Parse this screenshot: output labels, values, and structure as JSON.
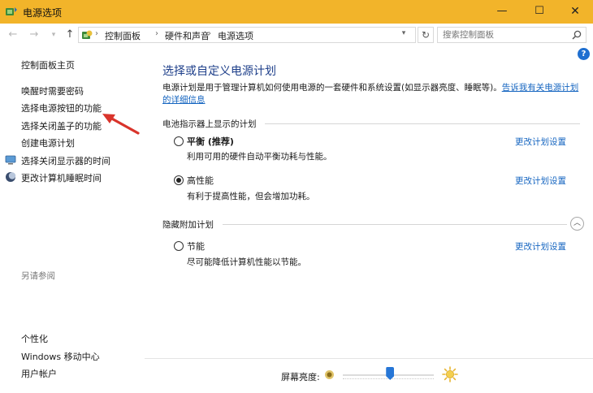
{
  "window": {
    "title": "电源选项",
    "minimize_label": "—",
    "maximize_label": "☐",
    "close_label": "✕"
  },
  "address": {
    "crumbs": [
      "控制面板",
      "硬件和声音",
      "电源选项"
    ],
    "search_placeholder": "搜索控制面板"
  },
  "left_pane": {
    "home": "控制面板主页",
    "links": [
      "唤醒时需要密码",
      "选择电源按钮的功能",
      "选择关闭盖子的功能",
      "创建电源计划",
      "选择关闭显示器的时间",
      "更改计算机睡眠时间"
    ],
    "see_also_title": "另请参阅",
    "see_also": [
      "个性化",
      "Windows 移动中心",
      "用户帐户"
    ]
  },
  "main": {
    "title": "选择或自定义电源计划",
    "description": "电源计划是用于管理计算机如何使用电源的一套硬件和系统设置(如显示器亮度、睡眠等)。",
    "description_link": "告诉我有关电源计划的详细信息",
    "battery_section": "电池指示器上显示的计划",
    "hidden_section": "隐藏附加计划",
    "change_link": "更改计划设置",
    "plans": [
      {
        "name": "平衡 (推荐)",
        "desc": "利用可用的硬件自动平衡功耗与性能。",
        "selected": false
      },
      {
        "name": "高性能",
        "desc": "有利于提高性能，但会增加功耗。",
        "selected": true
      },
      {
        "name": "节能",
        "desc": "尽可能降低计算机性能以节能。",
        "selected": false
      }
    ]
  },
  "brightness": {
    "label": "屏幕亮度:",
    "level_percent": 52
  },
  "colors": {
    "titlebar": "#f2b42a",
    "link": "#1565c0",
    "heading": "#1e3f8a",
    "slider_thumb": "#2676d6",
    "annotation_arrow": "#d9342b"
  }
}
